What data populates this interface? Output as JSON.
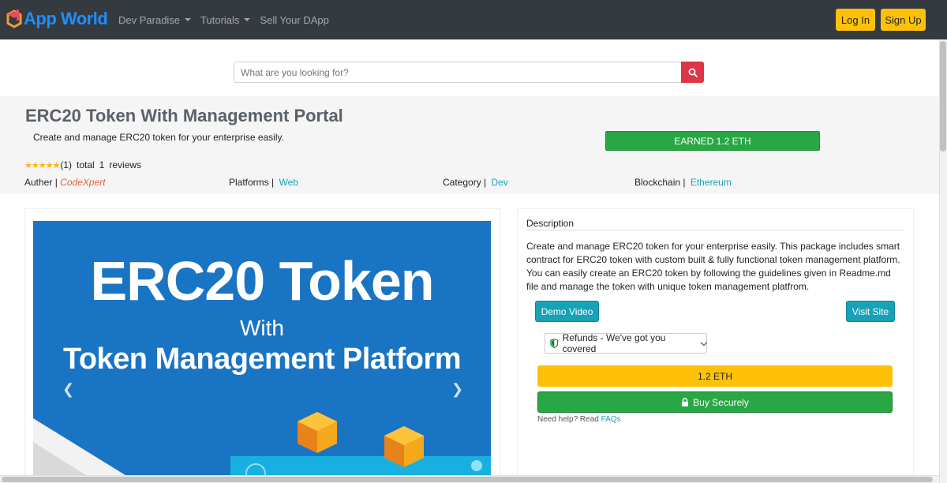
{
  "navbar": {
    "brand": "App World",
    "links": [
      {
        "label": "Dev Paradise",
        "dropdown": true
      },
      {
        "label": "Tutorials",
        "dropdown": true
      },
      {
        "label": "Sell Your DApp",
        "dropdown": false
      }
    ],
    "login_label": "Log In",
    "signup_label": "Sign Up"
  },
  "search": {
    "placeholder": "What are you looking for?",
    "icon": "search-icon"
  },
  "product": {
    "title": "ERC20 Token With Management Portal",
    "subtitle": "Create and manage ERC20 token for your enterprise easily.",
    "earned": "EARNED 1.2 ETH",
    "rating": {
      "stars": 5,
      "count_text": "(1)",
      "total_label": "total",
      "total_value": "1",
      "reviews_label": "reviews"
    },
    "meta": {
      "author_label": "Auther |",
      "author_value": "CodeXpert",
      "platforms_label": "Platforms |",
      "platforms_value": "Web",
      "category_label": "Category |",
      "category_value": "Dev",
      "blockchain_label": "Blockchain |",
      "blockchain_value": "Ethereum"
    }
  },
  "hero": {
    "line1": "ERC20 Token",
    "line2": "With",
    "line3": "Token Management Platform"
  },
  "details": {
    "description_heading": "Description",
    "description_text": "Create and manage ERC20 token for your enterprise easily. This package includes smart contract for ERC20 token with custom built & fully functional token management platform. You can easily create an ERC20 token by following the guidelines given in Readme.md file and manage the token with unique token management platfrom.",
    "demo_label": "Demo Video",
    "visit_label": "Visit Site",
    "refunds_label": "Refunds - We've got you covered",
    "price_label": "1.2 ETH",
    "buy_label": "Buy Securely",
    "help_text": "Need help? Read",
    "faq_label": "FAQs"
  },
  "colors": {
    "navbar_bg": "#343a40",
    "brand_blue": "#1e90ff",
    "accent_yellow": "#ffc107",
    "success_green": "#28a745",
    "info_teal": "#17a2b8",
    "danger_red": "#dc3545",
    "author_orange": "#e8603c"
  }
}
